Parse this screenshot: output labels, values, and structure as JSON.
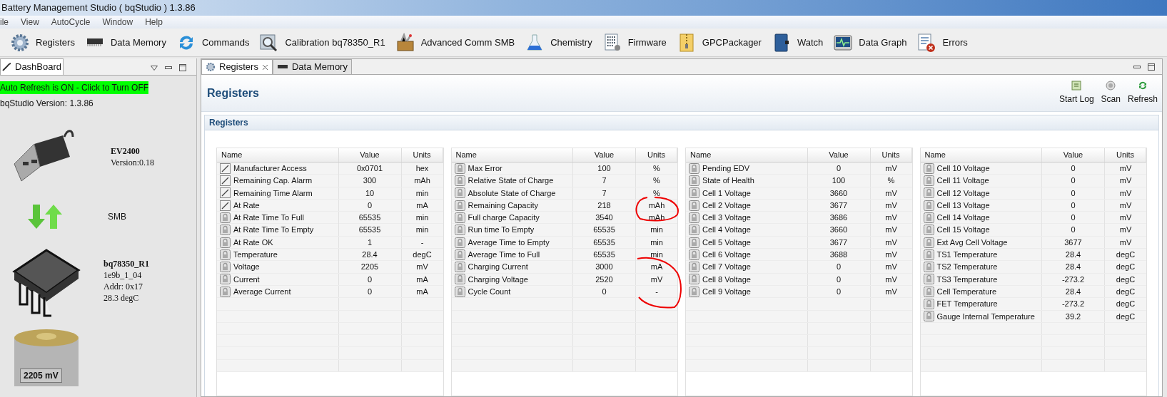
{
  "window": {
    "title": "Battery Management Studio ( bqStudio ) 1.3.86"
  },
  "menu": [
    "ile",
    "View",
    "AutoCycle",
    "Window",
    "Help"
  ],
  "toolbar": [
    {
      "label": "Registers",
      "kind": "gear"
    },
    {
      "label": "Data Memory",
      "kind": "chip"
    },
    {
      "label": "Commands",
      "kind": "arrows"
    },
    {
      "label": "Calibration bq78350_R1",
      "kind": "magnifier"
    },
    {
      "label": "Advanced Comm SMB",
      "kind": "toolbox"
    },
    {
      "label": "Chemistry",
      "kind": "flask"
    },
    {
      "label": "Firmware",
      "kind": "binary"
    },
    {
      "label": "GPCPackager",
      "kind": "zip"
    },
    {
      "label": "Watch",
      "kind": "book"
    },
    {
      "label": "Data Graph",
      "kind": "monitor"
    },
    {
      "label": "Errors",
      "kind": "errors"
    }
  ],
  "dashboard": {
    "tab": "DashBoard",
    "auto_refresh": {
      "label": "Auto Refresh is ON - Click to Turn OFF",
      "on": true
    },
    "version": "bqStudio Version:  1.3.86",
    "adapter": {
      "name": "EV2400",
      "version": "Version:0.18"
    },
    "bus": "SMB",
    "device": {
      "name": "bq78350_R1",
      "lines": [
        "1e9b_1_04",
        "Addr: 0x17",
        "28.3 degC"
      ]
    },
    "battery": {
      "voltage": "2205 mV"
    }
  },
  "editor_tabs": [
    {
      "label": "Registers",
      "selected": true,
      "closable": true
    },
    {
      "label": "Data Memory",
      "selected": false,
      "closable": false
    }
  ],
  "page": {
    "title": "Registers",
    "actions": [
      "Start Log",
      "Scan",
      "Refresh"
    ],
    "section": "Registers"
  },
  "tables": [
    {
      "columns": [
        "Name",
        "Value",
        "Units"
      ],
      "rows": [
        {
          "name": "Manufacturer Access",
          "value": "0x0701",
          "units": "hex",
          "kind": "writable"
        },
        {
          "name": "Remaining Cap. Alarm",
          "value": "300",
          "units": "mAh",
          "kind": "writable"
        },
        {
          "name": "Remaining Time Alarm",
          "value": "10",
          "units": "min",
          "kind": "writable"
        },
        {
          "name": "At Rate",
          "value": "0",
          "units": "mA",
          "kind": "writable"
        },
        {
          "name": "At Rate Time To Full",
          "value": "65535",
          "units": "min",
          "kind": "readonly"
        },
        {
          "name": "At Rate Time To Empty",
          "value": "65535",
          "units": "min",
          "kind": "readonly"
        },
        {
          "name": "At Rate OK",
          "value": "1",
          "units": "-",
          "kind": "readonly"
        },
        {
          "name": "Temperature",
          "value": "28.4",
          "units": "degC",
          "kind": "readonly"
        },
        {
          "name": "Voltage",
          "value": "2205",
          "units": "mV",
          "kind": "readonly"
        },
        {
          "name": "Current",
          "value": "0",
          "units": "mA",
          "kind": "readonly"
        },
        {
          "name": "Average Current",
          "value": "0",
          "units": "mA",
          "kind": "readonly"
        }
      ]
    },
    {
      "columns": [
        "Name",
        "Value",
        "Units"
      ],
      "rows": [
        {
          "name": "Max Error",
          "value": "100",
          "units": "%",
          "kind": "readonly"
        },
        {
          "name": "Relative State of Charge",
          "value": "7",
          "units": "%",
          "kind": "readonly"
        },
        {
          "name": "Absolute State of Charge",
          "value": "7",
          "units": "%",
          "kind": "readonly"
        },
        {
          "name": "Remaining Capacity",
          "value": "218",
          "units": "mAh",
          "kind": "readonly"
        },
        {
          "name": "Full charge Capacity",
          "value": "3540",
          "units": "mAh",
          "kind": "readonly"
        },
        {
          "name": "Run time To Empty",
          "value": "65535",
          "units": "min",
          "kind": "readonly"
        },
        {
          "name": "Average Time to Empty",
          "value": "65535",
          "units": "min",
          "kind": "readonly"
        },
        {
          "name": "Average Time to Full",
          "value": "65535",
          "units": "min",
          "kind": "readonly"
        },
        {
          "name": "Charging Current",
          "value": "3000",
          "units": "mA",
          "kind": "readonly"
        },
        {
          "name": "Charging Voltage",
          "value": "2520",
          "units": "mV",
          "kind": "readonly"
        },
        {
          "name": "Cycle Count",
          "value": "0",
          "units": "-",
          "kind": "readonly"
        }
      ]
    },
    {
      "columns": [
        "Name",
        "Value",
        "Units"
      ],
      "rows": [
        {
          "name": "Pending EDV",
          "value": "0",
          "units": "mV",
          "kind": "readonly"
        },
        {
          "name": "State of Health",
          "value": "100",
          "units": "%",
          "kind": "readonly"
        },
        {
          "name": "Cell 1 Voltage",
          "value": "3660",
          "units": "mV",
          "kind": "readonly"
        },
        {
          "name": "Cell 2 Voltage",
          "value": "3677",
          "units": "mV",
          "kind": "readonly"
        },
        {
          "name": "Cell 3 Voltage",
          "value": "3686",
          "units": "mV",
          "kind": "readonly"
        },
        {
          "name": "Cell 4 Voltage",
          "value": "3660",
          "units": "mV",
          "kind": "readonly"
        },
        {
          "name": "Cell 5 Voltage",
          "value": "3677",
          "units": "mV",
          "kind": "readonly"
        },
        {
          "name": "Cell 6 Voltage",
          "value": "3688",
          "units": "mV",
          "kind": "readonly"
        },
        {
          "name": "Cell 7 Voltage",
          "value": "0",
          "units": "mV",
          "kind": "readonly"
        },
        {
          "name": "Cell 8 Voltage",
          "value": "0",
          "units": "mV",
          "kind": "readonly"
        },
        {
          "name": "Cell 9 Voltage",
          "value": "0",
          "units": "mV",
          "kind": "readonly"
        }
      ]
    },
    {
      "columns": [
        "Name",
        "Value",
        "Units"
      ],
      "rows": [
        {
          "name": "Cell 10 Voltage",
          "value": "0",
          "units": "mV",
          "kind": "readonly"
        },
        {
          "name": "Cell 11 Voltage",
          "value": "0",
          "units": "mV",
          "kind": "readonly"
        },
        {
          "name": "Cell 12 Voltage",
          "value": "0",
          "units": "mV",
          "kind": "readonly"
        },
        {
          "name": "Cell 13 Voltage",
          "value": "0",
          "units": "mV",
          "kind": "readonly"
        },
        {
          "name": "Cell 14 Voltage",
          "value": "0",
          "units": "mV",
          "kind": "readonly"
        },
        {
          "name": "Cell 15 Voltage",
          "value": "0",
          "units": "mV",
          "kind": "readonly"
        },
        {
          "name": "Ext Avg Cell Voltage",
          "value": "3677",
          "units": "mV",
          "kind": "readonly"
        },
        {
          "name": "TS1 Temperature",
          "value": "28.4",
          "units": "degC",
          "kind": "readonly"
        },
        {
          "name": "TS2 Temperature",
          "value": "28.4",
          "units": "degC",
          "kind": "readonly"
        },
        {
          "name": "TS3 Temperature",
          "value": "-273.2",
          "units": "degC",
          "kind": "readonly"
        },
        {
          "name": "Cell Temperature",
          "value": "28.4",
          "units": "degC",
          "kind": "readonly"
        },
        {
          "name": "FET Temperature",
          "value": "-273.2",
          "units": "degC",
          "kind": "readonly"
        },
        {
          "name": "Gauge Internal Temperature",
          "value": "39.2",
          "units": "degC",
          "kind": "readonly"
        }
      ]
    }
  ]
}
